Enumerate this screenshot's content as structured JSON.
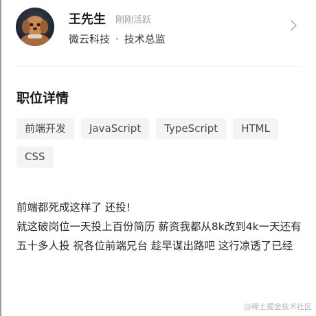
{
  "recruiter": {
    "name": "王先生",
    "active_status": "刚刚活跃",
    "company": "微云科技",
    "separator": "·",
    "title": "技术总监"
  },
  "job_details": {
    "heading": "职位详情",
    "tags": [
      "前端开发",
      "JavaScript",
      "TypeScript",
      "HTML",
      "CSS"
    ]
  },
  "description": {
    "lines": [
      "前端都死成这样了 还投!",
      "就这破岗位一天投上百份简历 薪资我都从8k改到4k一天还有五十多人投 祝各位前端兄台 趁早谋出路吧 这行凉透了已经"
    ]
  },
  "watermark": "@稀土掘金技术社区",
  "icons": {
    "avatar": "avatar-image",
    "chevron": "chevron-right-icon"
  }
}
